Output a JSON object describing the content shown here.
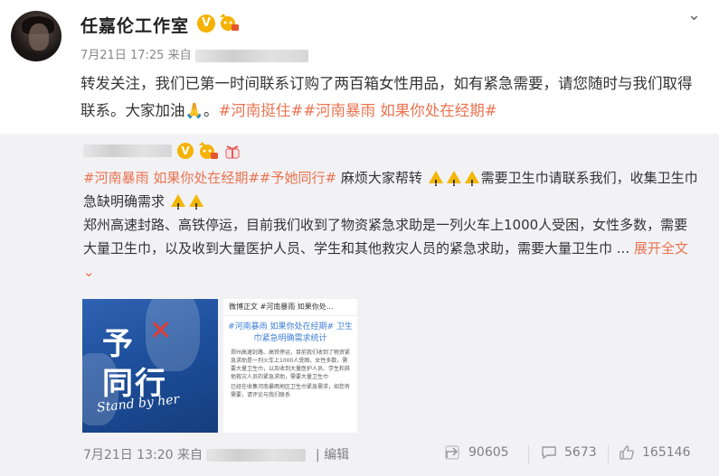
{
  "header": {
    "name": "任嘉伦工作室",
    "verified_badge": "V",
    "date_time": "7月21日 17:25",
    "source_prefix": "来自"
  },
  "post": {
    "text_before": "转发关注，我们已第一时间联系订购了两百箱女性用品，如有紧急需要，请您随时与我们取得联系。大家加油",
    "emoji": "🙏",
    "text_after": "。",
    "tags": [
      "#河南挺住#",
      "#河南暴雨 如果你处在经期#"
    ]
  },
  "repost": {
    "verified_badge": "V",
    "tags": [
      "#河南暴雨 如果你处在经期#",
      "#予她同行#"
    ],
    "line1_text": " 麻烦大家帮转",
    "line1_text2": "需要卫生巾请联系我们，收集卫生巾急缺明确需求",
    "body": "郑州高速封路、高铁停运，目前我们收到了物资紧急求助是一列火车上1000人受困，女性多数，需要大量卫生巾，以及收到大量医护人员、学生和其他救灾人员的紧急求助，需要大量卫生巾",
    "ellipsis": " ...",
    "expand_label": "展开全文",
    "expand_icon": "chevron-down",
    "image1": {
      "title_top": "予",
      "title_bottom": "同行",
      "script": "Stand by her"
    },
    "image2": {
      "bar": "微博正文 #河南暴雨 如果你处...",
      "heading": "#河南暴雨 如果你处在经期# 卫生巾紧急明确需求统计",
      "para1": "郑州高速封路、高铁停运，目前我们收到了物资紧急求助是一列火车上1000人受困，女性多数，需要大量卫生巾，以及收到大量医护人员、学生和其他救灾人员的紧急求助，需要大量卫生巾",
      "para2": "已经在收集河南暴雨地区卫生巾紧急需求，如您有需要，请评论与我们联系"
    },
    "footer": {
      "date_time": "7月21日 13:20",
      "source_prefix": "来自",
      "edit_label": "编辑",
      "repost_count": "90605",
      "comment_count": "5673",
      "like_count": "165146"
    }
  },
  "colors": {
    "tag": "#eb7350",
    "badge": "#f6b200",
    "repost_bg": "#f2f2f5"
  }
}
